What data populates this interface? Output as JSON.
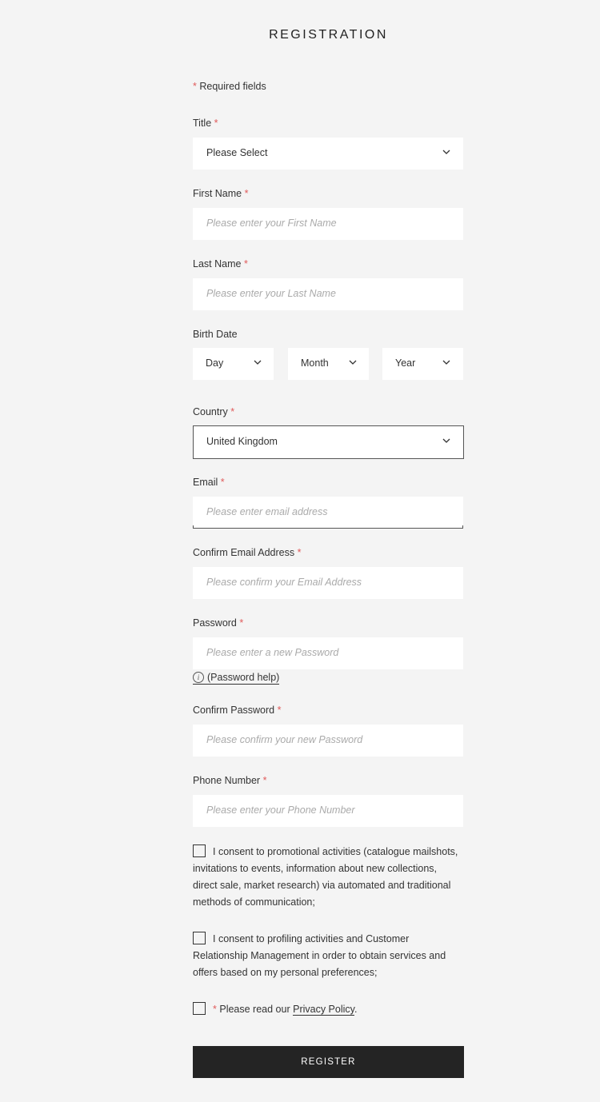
{
  "page": {
    "title": "REGISTRATION",
    "required_note": "Required fields",
    "required_marker": "*"
  },
  "fields": {
    "title": {
      "label": "Title",
      "value": "Please Select"
    },
    "first_name": {
      "label": "First Name",
      "placeholder": "Please enter your First Name"
    },
    "last_name": {
      "label": "Last Name",
      "placeholder": "Please enter your Last Name"
    },
    "birth_date": {
      "label": "Birth Date",
      "day": "Day",
      "month": "Month",
      "year": "Year"
    },
    "country": {
      "label": "Country",
      "value": "United Kingdom"
    },
    "email": {
      "label": "Email",
      "placeholder": "Please enter email address"
    },
    "confirm_email": {
      "label": "Confirm Email Address",
      "placeholder": "Please confirm your Email Address"
    },
    "password": {
      "label": "Password",
      "placeholder": "Please enter a new Password",
      "help_link": "(Password help)"
    },
    "confirm_password": {
      "label": "Confirm Password",
      "placeholder": "Please confirm your new Password"
    },
    "phone": {
      "label": "Phone Number",
      "placeholder": "Please enter your Phone Number"
    }
  },
  "consents": {
    "promotional": {
      "text": "I consent to promotional activities (catalogue mailshots, invitations to events, information about new collections, direct sale, market research) via automated and traditional methods of communication;",
      "checked": false
    },
    "profiling": {
      "text": "I consent to profiling activities and Customer Relationship Management in order to obtain services and offers based on my personal preferences;",
      "checked": false
    },
    "privacy": {
      "prefix": "Please read our",
      "link": "Privacy Policy",
      "suffix": ".",
      "checked": false
    }
  },
  "actions": {
    "register_label": "REGISTER"
  },
  "colors": {
    "accent_required": "#e05a5a",
    "button_bg": "#242424",
    "page_bg": "#f4f4f4"
  }
}
